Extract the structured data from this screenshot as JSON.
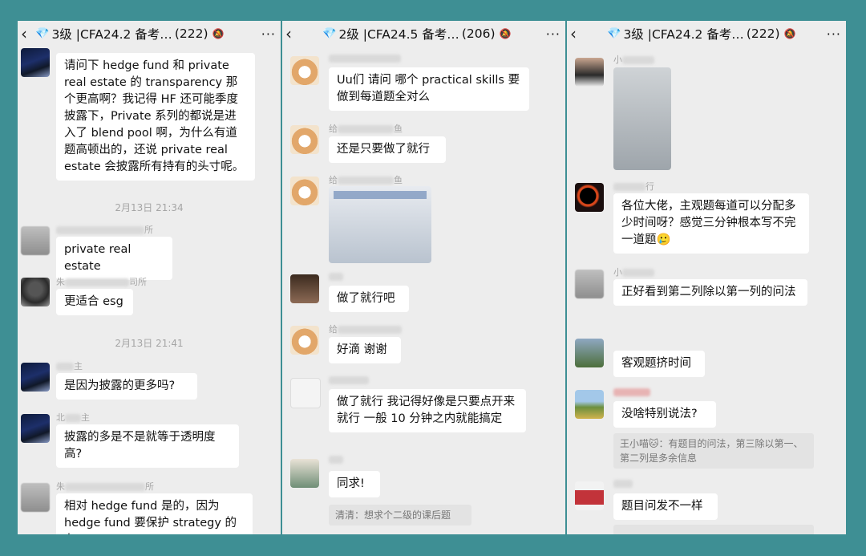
{
  "panels": [
    {
      "title": "3级 |CFA24.2 备考…",
      "count": "(222)",
      "date1": "2月13日 21:34",
      "date2": "2月13日 21:41",
      "msg1": "请问下 hedge fund 和 private real estate 的 transparency 那个更高啊？我记得 HF 还可能季度披露下，Private 系列的都说是进入了 blend pool 啊，为什么有道题高顿出的，还说 private real estate 会披露所有持有的头寸呢。",
      "name2": "所",
      "msg2": "private real estate",
      "name3a": "朱",
      "name3b": "司所",
      "msg3": "更适合 esg",
      "name4": "主",
      "msg4": "是因为披露的更多吗?",
      "name5a": "北",
      "name5b": "主",
      "msg5": "披露的多是不是就等于透明度高?",
      "name6a": "朱",
      "name6b": "所",
      "msg6": "相对 hedge fund 是的，因为 hedge fund 要保护 strategy 的有"
    },
    {
      "title": "2级 |CFA24.5 备考…",
      "count": "(206)",
      "msg1": "Uu们 请问 哪个 practical skills 要做到每道题全对么",
      "name2a": "给",
      "name2b": "鱼",
      "msg2": "还是只要做了就行",
      "name3a": "给",
      "name3b": "鱼",
      "msg4": "做了就行吧",
      "name5": "给",
      "msg5": "好滴 谢谢",
      "msg6": "做了就行 我记得好像是只要点开来就行 一般 10 分钟之内就能搞定",
      "msg7": "同求!",
      "quote7": "清清：想求个二级的课后题"
    },
    {
      "title": "3级 |CFA24.2 备考…",
      "count": "(222)",
      "name1": "小",
      "name2": "行",
      "msg2": "各位大佬，主观题每道可以分配多少时间呀？感觉三分钟根本写不完一道题🥲",
      "name3": "小",
      "msg3": "正好看到第二列除以第一列的问法",
      "msg4": "客观题挤时间",
      "msg5": "没啥特别说法?",
      "quote5": "王小喵🐱：有题目的问法，第三除以第一、第二列是多余信息",
      "msg6": "题目问发不一样"
    }
  ],
  "icons": {
    "back": "‹",
    "gem": "💎",
    "more": "···",
    "mute": "🔕"
  }
}
